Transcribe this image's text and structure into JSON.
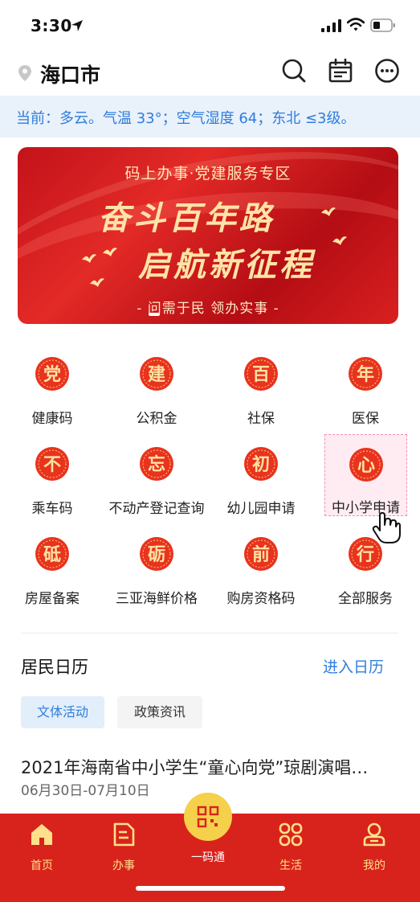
{
  "status_bar": {
    "time": "3:30"
  },
  "header": {
    "city": "海口市"
  },
  "weather": {
    "text": "当前：多云。气温 33°；空气湿度 64；东北 ≤3级。"
  },
  "banner": {
    "subtitle": "码上办事·党建服务专区",
    "line1": "奋斗百年路",
    "line2": "启航新征程",
    "slogan": "- 问需于民 领办实事 -"
  },
  "services": [
    {
      "badge": "党",
      "label": "健康码"
    },
    {
      "badge": "建",
      "label": "公积金"
    },
    {
      "badge": "百",
      "label": "社保"
    },
    {
      "badge": "年",
      "label": "医保"
    },
    {
      "badge": "不",
      "label": "乘车码"
    },
    {
      "badge": "忘",
      "label": "不动产登记查询"
    },
    {
      "badge": "初",
      "label": "幼儿园申请"
    },
    {
      "badge": "心",
      "label": "中小学申请"
    },
    {
      "badge": "砥",
      "label": "房屋备案"
    },
    {
      "badge": "砺",
      "label": "三亚海鲜价格"
    },
    {
      "badge": "前",
      "label": "购房资格码"
    },
    {
      "badge": "行",
      "label": "全部服务"
    }
  ],
  "calendar": {
    "title": "居民日历",
    "link": "进入日历",
    "tabs": [
      "文体活动",
      "政策资讯"
    ],
    "event": {
      "title": "2021年海南省中小学生“童心向党”琼剧演唱…",
      "date": "06月30日-07月10日"
    }
  },
  "bottom_nav": {
    "items": [
      "首页",
      "办事",
      "生活",
      "我的"
    ],
    "center_label": "一码通"
  },
  "colors": {
    "brand_red": "#d8231c",
    "accent_blue": "#2f7ddb",
    "nav_gold": "#ffe08a",
    "center_gold": "#f4d04b"
  }
}
